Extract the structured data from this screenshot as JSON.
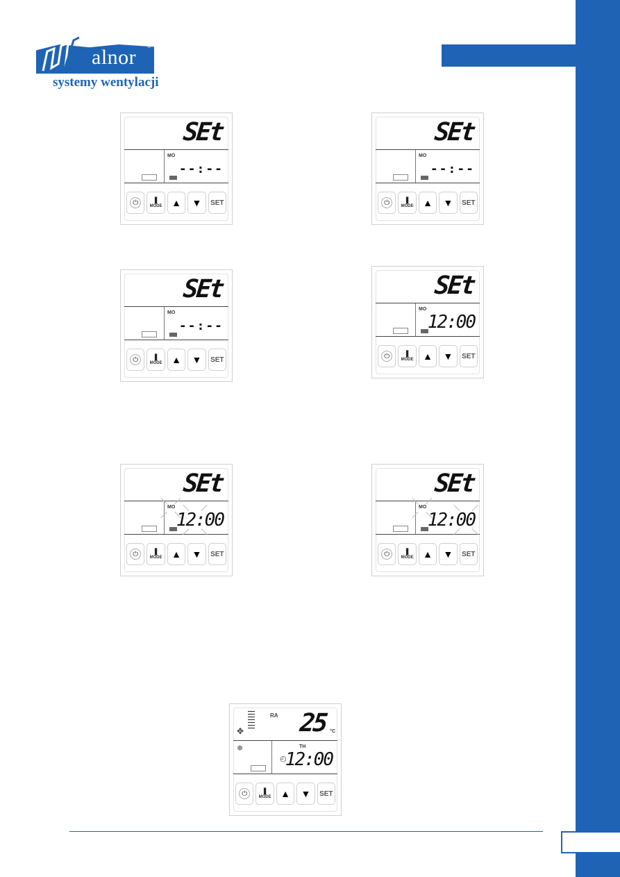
{
  "brand": {
    "color": "#1f64b4",
    "logo_word": "alnor",
    "logo_reg": "®",
    "logo_tagline": "systemy wentylacji"
  },
  "controllers": [
    {
      "id": "c1",
      "main_display": "SEt",
      "day": "MO",
      "time": "--:--",
      "blink_day": false,
      "blink_time": "none"
    },
    {
      "id": "c2",
      "main_display": "SEt",
      "day": "MO",
      "time": "--:--",
      "blink_day": false,
      "blink_time": "none"
    },
    {
      "id": "c3",
      "main_display": "SEt",
      "day": "MO",
      "time": "--:--",
      "blink_day": false,
      "blink_time": "none"
    },
    {
      "id": "c4",
      "main_display": "SEt",
      "day": "MO",
      "time": "12:00",
      "blink_day": false,
      "blink_time": "none"
    },
    {
      "id": "c5",
      "main_display": "SEt",
      "day": "MO",
      "time": "12:00",
      "blink_day": true,
      "blink_time": "hours"
    },
    {
      "id": "c6",
      "main_display": "SEt",
      "day": "MO",
      "time": "12:00",
      "blink_day": true,
      "blink_time": "minutes"
    }
  ],
  "final_controller": {
    "mode_label": "RA",
    "temperature": "25",
    "unit": "°C",
    "day": "TH",
    "time": "12:00",
    "fan_levels": 7
  },
  "buttons": {
    "power": "⏻",
    "mode_icon": "❚",
    "mode": "MODE",
    "up": "▲",
    "down": "▼",
    "set": "SET"
  }
}
